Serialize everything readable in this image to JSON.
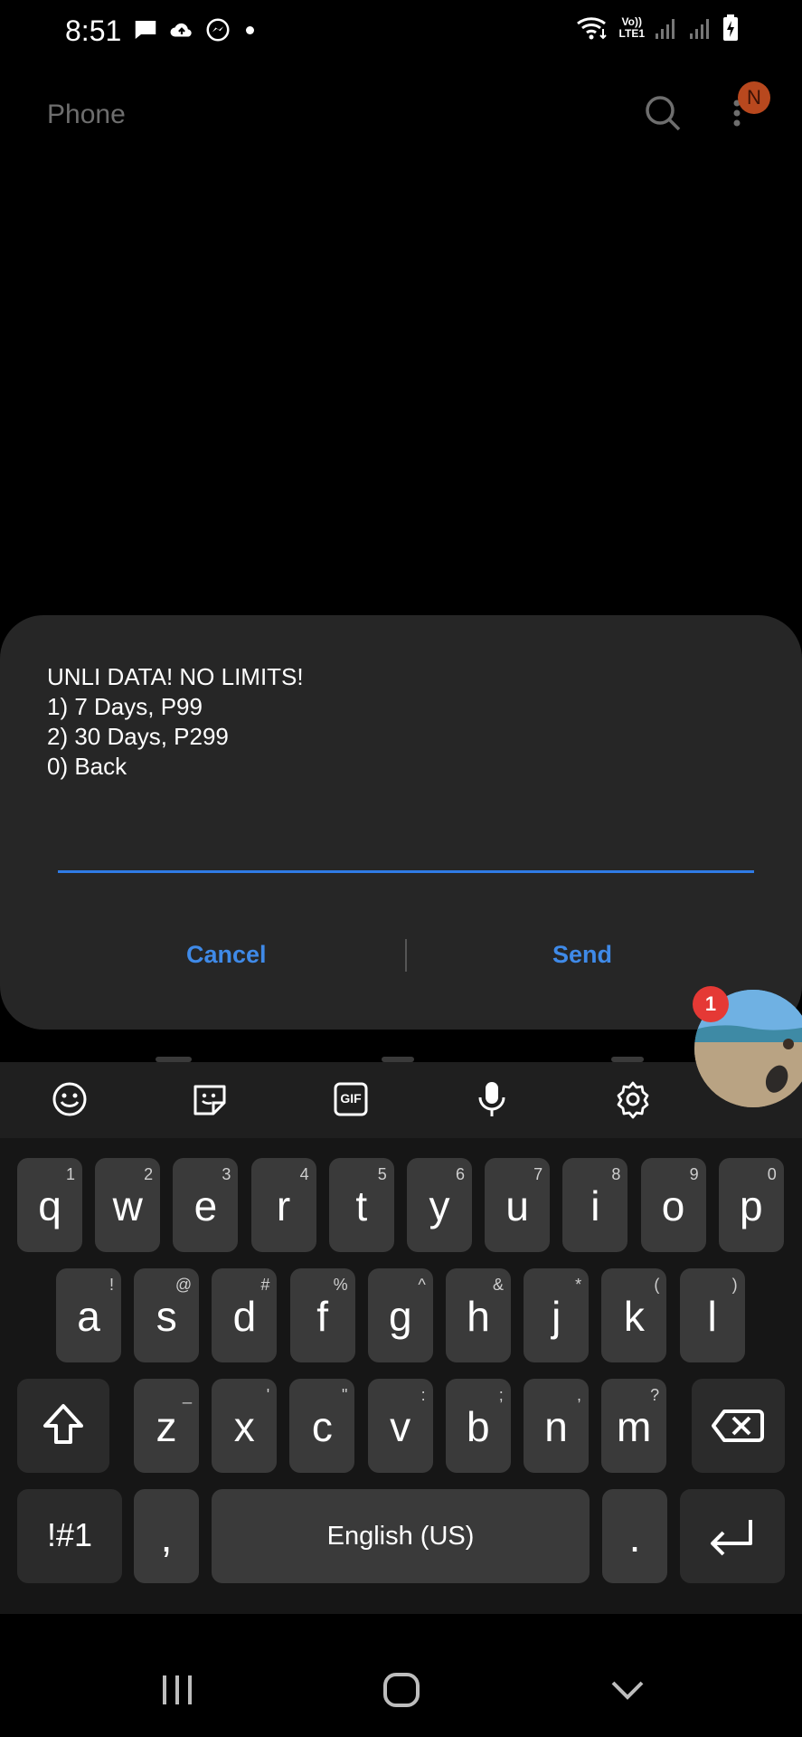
{
  "status_bar": {
    "time": "8:51",
    "volte": "Vo))",
    "lte": "LTE1",
    "left_icons": [
      "message-icon",
      "cloud-upload-icon",
      "messenger-icon",
      "dot-icon"
    ],
    "right_icons": [
      "wifi-icon",
      "signal-icon",
      "signal-icon",
      "battery-charging-icon"
    ]
  },
  "app": {
    "title": "Phone",
    "avatar_initial": "N"
  },
  "dialog": {
    "lines": [
      "UNLI DATA! NO LIMITS!",
      "1) 7 Days, P99",
      "2) 30 Days, P299",
      "0) Back"
    ],
    "input_value": "",
    "cancel_label": "Cancel",
    "send_label": "Send"
  },
  "chat_head": {
    "badge_count": "1"
  },
  "keyboard": {
    "toolbar": [
      "emoji-icon",
      "sticker-icon",
      "gif-icon",
      "microphone-icon",
      "settings-icon"
    ],
    "gif_label": "GIF",
    "row1": [
      {
        "k": "q",
        "s": "1"
      },
      {
        "k": "w",
        "s": "2"
      },
      {
        "k": "e",
        "s": "3"
      },
      {
        "k": "r",
        "s": "4"
      },
      {
        "k": "t",
        "s": "5"
      },
      {
        "k": "y",
        "s": "6"
      },
      {
        "k": "u",
        "s": "7"
      },
      {
        "k": "i",
        "s": "8"
      },
      {
        "k": "o",
        "s": "9"
      },
      {
        "k": "p",
        "s": "0"
      }
    ],
    "row2": [
      {
        "k": "a",
        "s": "!"
      },
      {
        "k": "s",
        "s": "@"
      },
      {
        "k": "d",
        "s": "#"
      },
      {
        "k": "f",
        "s": "%"
      },
      {
        "k": "g",
        "s": "^"
      },
      {
        "k": "h",
        "s": "&"
      },
      {
        "k": "j",
        "s": "*"
      },
      {
        "k": "k",
        "s": "("
      },
      {
        "k": "l",
        "s": ")"
      }
    ],
    "row3": [
      {
        "k": "z",
        "s": "_"
      },
      {
        "k": "x",
        "s": "'"
      },
      {
        "k": "c",
        "s": "\""
      },
      {
        "k": "v",
        "s": ":"
      },
      {
        "k": "b",
        "s": ";"
      },
      {
        "k": "n",
        "s": ","
      },
      {
        "k": "m",
        "s": "?"
      }
    ],
    "symbols_label": "!#1",
    "comma_label": ",",
    "space_label": "English (US)",
    "period_label": "."
  },
  "nav": {
    "buttons": [
      "recents-icon",
      "home-icon",
      "back-icon"
    ]
  }
}
